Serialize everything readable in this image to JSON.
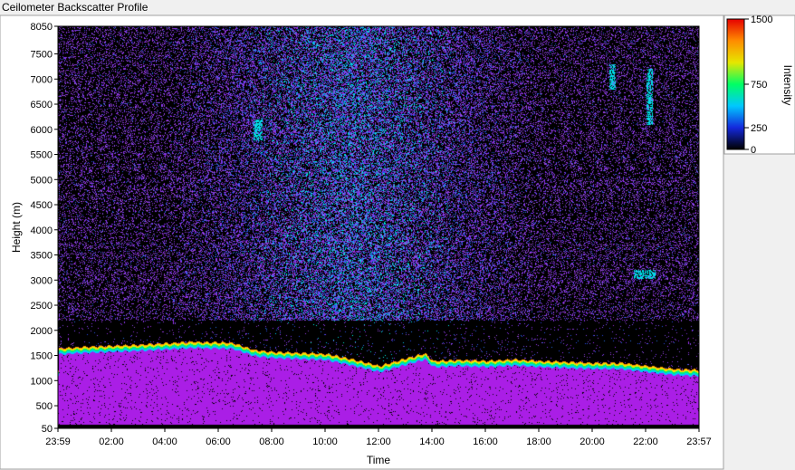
{
  "window": {
    "title": "Ceilometer Backscatter Profile"
  },
  "chart_data": {
    "type": "heatmap",
    "title": "Ceilometer Backscatter Profile",
    "xlabel": "Time",
    "ylabel": "Height (m)",
    "x_ticks": [
      "23:59",
      "02:00",
      "04:00",
      "06:00",
      "08:00",
      "10:00",
      "12:00",
      "14:00",
      "16:00",
      "18:00",
      "20:00",
      "22:00",
      "23:57"
    ],
    "y_ticks": [
      50,
      500,
      1000,
      1500,
      2000,
      2500,
      3000,
      3500,
      4000,
      4500,
      5000,
      5500,
      6000,
      6500,
      7000,
      7500,
      8050
    ],
    "ylim": [
      50,
      8050
    ],
    "xlim_hours": [
      -0.0167,
      23.95
    ],
    "colorbar": {
      "label": "Intensity",
      "ticks": [
        0,
        250,
        750,
        1500
      ],
      "range": [
        0,
        1500
      ],
      "colors": [
        "#000000",
        "#1428dc",
        "#00c8ff",
        "#00ff64",
        "#e6e600",
        "#ff8c00",
        "#e60000"
      ]
    },
    "layers": {
      "boundary_layer_top_m": [
        [
          0,
          1650
        ],
        [
          1,
          1680
        ],
        [
          3,
          1720
        ],
        [
          5,
          1780
        ],
        [
          6.5,
          1760
        ],
        [
          7.3,
          1620
        ],
        [
          8,
          1580
        ],
        [
          9,
          1560
        ],
        [
          10,
          1540
        ],
        [
          11,
          1430
        ],
        [
          12,
          1300
        ],
        [
          13,
          1450
        ],
        [
          13.7,
          1550
        ],
        [
          14,
          1400
        ],
        [
          15,
          1420
        ],
        [
          16,
          1400
        ],
        [
          17,
          1430
        ],
        [
          18,
          1400
        ],
        [
          19,
          1380
        ],
        [
          20,
          1360
        ],
        [
          21,
          1360
        ],
        [
          22,
          1300
        ],
        [
          23,
          1240
        ],
        [
          23.95,
          1220
        ]
      ],
      "noise_floor_m": 2200,
      "elevated_layers": [
        {
          "x_hours": [
            20.6,
            20.8
          ],
          "height_m": [
            6800,
            7300
          ],
          "intensity": 300
        },
        {
          "x_hours": [
            22.0,
            22.2
          ],
          "height_m": [
            6100,
            7200
          ],
          "intensity": 300
        },
        {
          "x_hours": [
            21.5,
            22.3
          ],
          "height_m": [
            3050,
            3200
          ],
          "intensity": 350
        },
        {
          "x_hours": [
            7.3,
            7.6
          ],
          "height_m": [
            5800,
            6200
          ],
          "intensity": 250
        }
      ]
    }
  }
}
